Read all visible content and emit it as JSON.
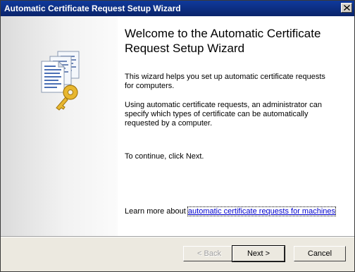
{
  "window": {
    "title": "Automatic Certificate Request Setup Wizard",
    "close_icon": "close-icon"
  },
  "side_panel": {
    "icon": "certificate-documents-key-icon"
  },
  "content": {
    "heading": "Welcome to the Automatic Certificate Request Setup Wizard",
    "paragraph1": "This wizard helps you set up automatic certificate requests for computers.",
    "paragraph2": "Using automatic certificate requests, an administrator can specify which types of certificate can be automatically requested by a computer.",
    "paragraph3": "To continue, click Next.",
    "learn_more_prefix": "Learn more about",
    "learn_more_link": "automatic certificate requests for machines"
  },
  "footer": {
    "back_label": "< Back",
    "next_label": "Next >",
    "cancel_label": "Cancel"
  },
  "colors": {
    "titlebar": "#0a246a",
    "link": "#0000cc",
    "footer_bg": "#ece9e0"
  }
}
